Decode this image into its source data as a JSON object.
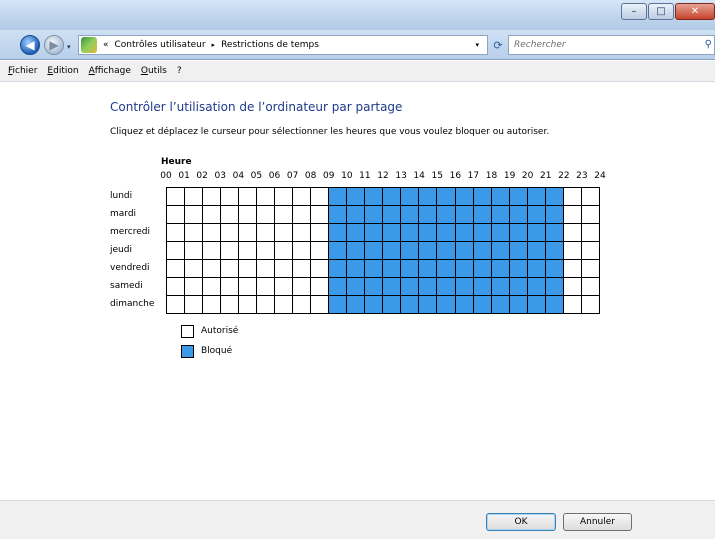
{
  "window": {
    "minimize_glyph": "–",
    "maximize_glyph": "□",
    "close_glyph": "✕"
  },
  "navigation": {
    "back_glyph": "◀",
    "forward_glyph": "▶",
    "history_glyph": "▾",
    "breadcrumb_prefix": "«",
    "breadcrumb": [
      "Contrôles utilisateur",
      "Restrictions de temps"
    ],
    "breadcrumb_separator": "▸",
    "address_dropdown_glyph": "▾",
    "refresh_glyph": "⟳",
    "search_placeholder": "Rechercher",
    "search_glyph": "⚲"
  },
  "menu": [
    "Fichier",
    "Edition",
    "Affichage",
    "Outils",
    "?"
  ],
  "page": {
    "heading": "Contrôler l’utilisation de l’ordinateur par partage",
    "instructions": "Cliquez et déplacez le curseur pour sélectionner les heures que vous voulez bloquer ou autoriser.",
    "hours_label": "Heure",
    "hours": [
      "00",
      "01",
      "02",
      "03",
      "04",
      "05",
      "06",
      "07",
      "08",
      "09",
      "10",
      "11",
      "12",
      "13",
      "14",
      "15",
      "16",
      "17",
      "18",
      "19",
      "20",
      "21",
      "22",
      "23",
      "24"
    ],
    "days": [
      "lundi",
      "mardi",
      "mercredi",
      "jeudi",
      "vendredi",
      "samedi",
      "dimanche"
    ],
    "blocked_from_hour": 9,
    "blocked_to_hour": 22,
    "legend": {
      "allowed": "Autorisé",
      "blocked": "Bloqué"
    },
    "colors": {
      "blocked": "#3c99e8",
      "allowed": "#ffffff"
    }
  },
  "buttons": {
    "ok": "OK",
    "cancel": "Annuler"
  }
}
